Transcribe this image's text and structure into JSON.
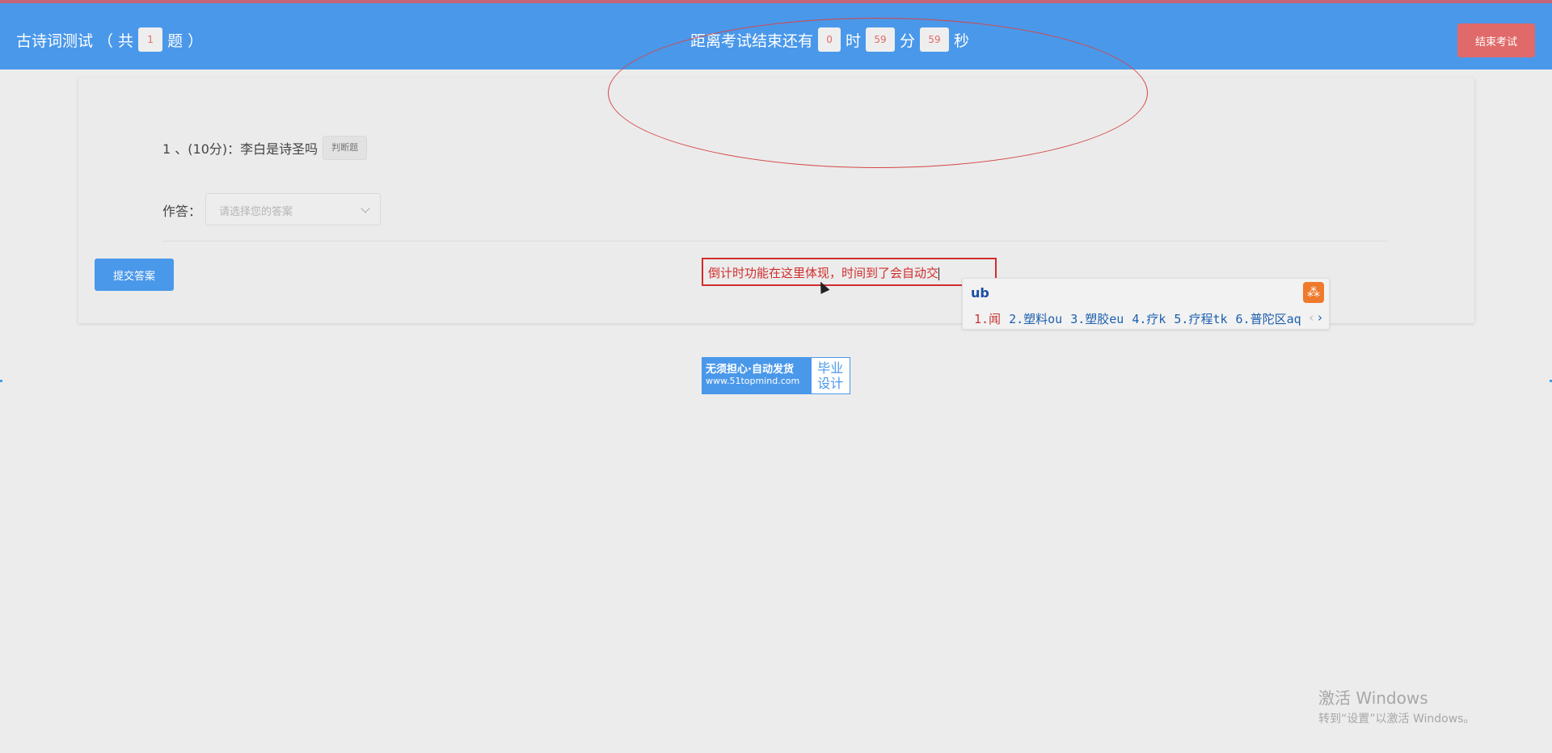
{
  "header": {
    "title": "古诗词测试",
    "count_prefix": "（ 共",
    "count": "1",
    "count_suffix": "题 ）",
    "countdown_prefix": "距离考试结束还有",
    "hours": "0",
    "hours_unit": "时",
    "minutes": "59",
    "minutes_unit": "分",
    "seconds": "59",
    "seconds_unit": "秒",
    "end_button": "结束考试"
  },
  "question": {
    "text": "1 、(10分)：李白是诗圣吗",
    "type_tag": "判断题",
    "answer_label": "作答：",
    "answer_placeholder": "请选择您的答案"
  },
  "submit_button": "提交答案",
  "annotation": {
    "note": "倒计时功能在这里体现，时间到了会自动交"
  },
  "ime": {
    "input": "ub",
    "candidates": [
      "1.闻",
      "2.塑料ou",
      "3.塑胶eu",
      "4.疗k",
      "5.疗程tk",
      "6.普陀区aq"
    ]
  },
  "banner": {
    "line1": "无须担心·自动发货",
    "line2": "www.51topmind.com",
    "right1": "毕业",
    "right2": "设计"
  },
  "watermark": {
    "line1": "激活 Windows",
    "line2": "转到“设置”以激活 Windows。"
  },
  "colors": {
    "header_bg": "#4a98ea",
    "danger": "#e06a6a",
    "annotation": "#d12d2d"
  }
}
